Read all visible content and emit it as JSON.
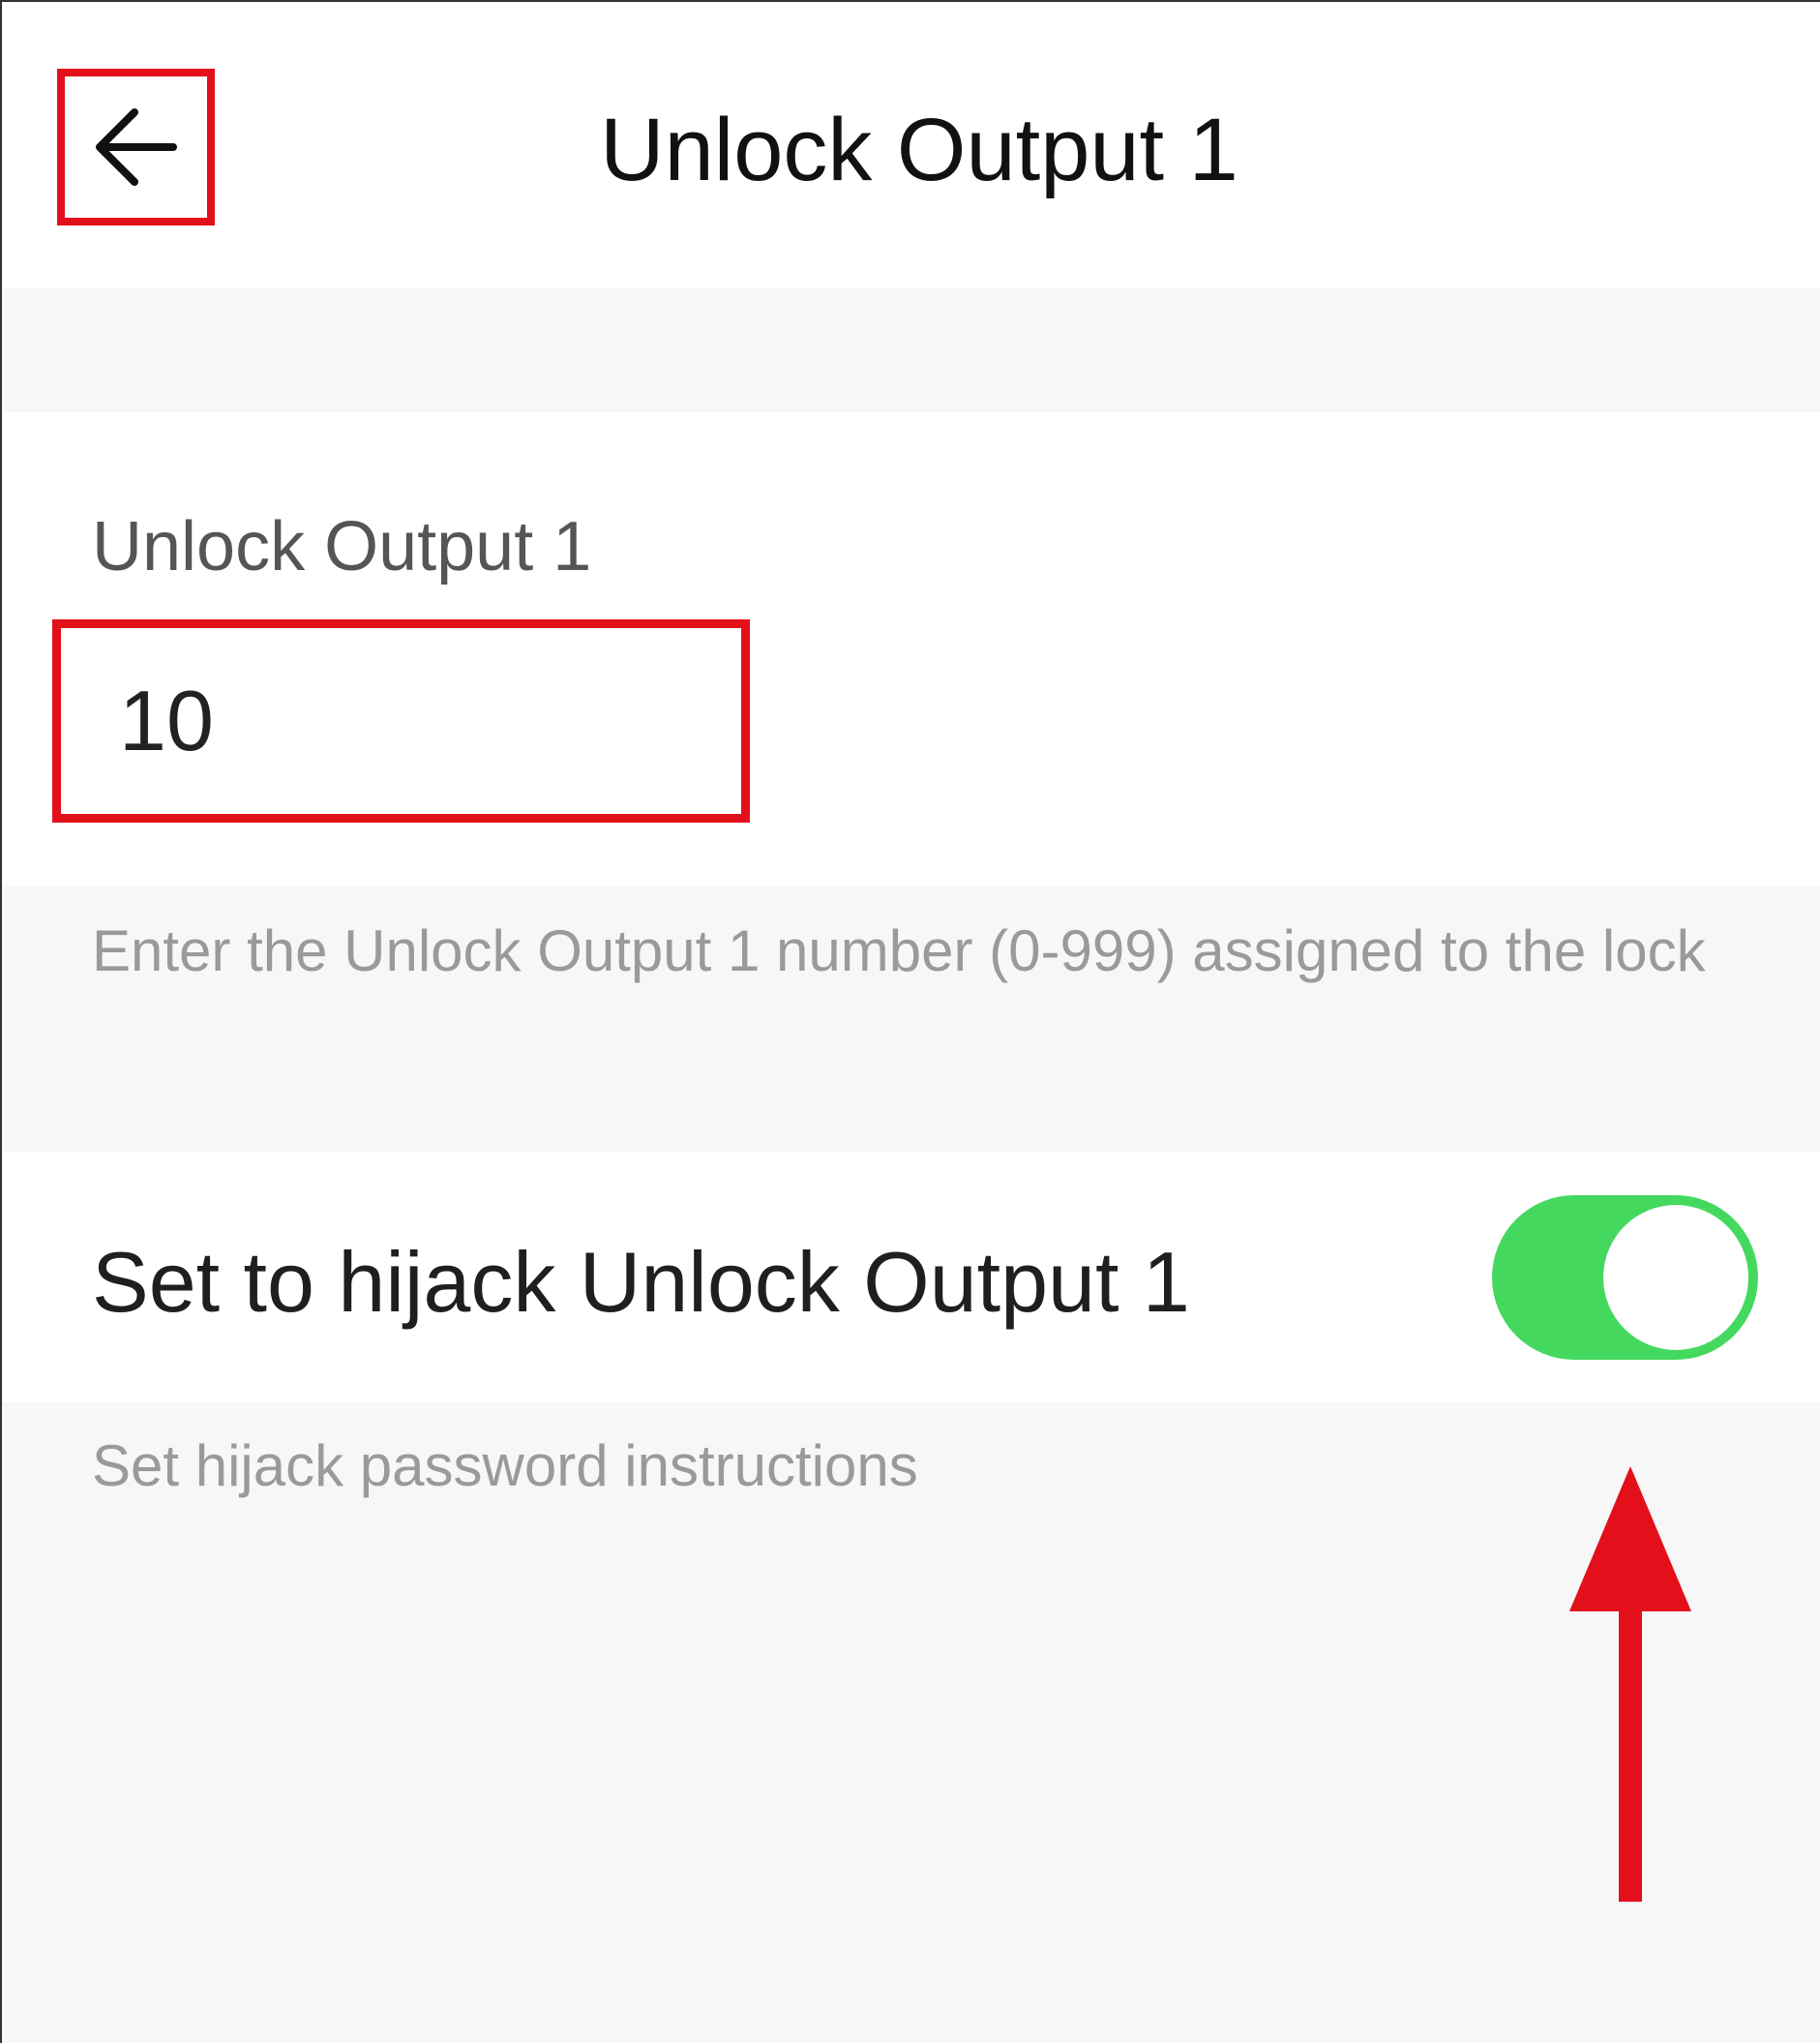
{
  "header": {
    "title": "Unlock Output 1",
    "back_icon": "arrow-left-icon"
  },
  "unlock_output": {
    "label": "Unlock Output 1",
    "value": "10",
    "hint": "Enter the Unlock Output 1 number (0-999) assigned to the lock"
  },
  "hijack": {
    "label": "Set to hijack Unlock Output 1",
    "enabled": true,
    "hint": "Set hijack password instructions"
  },
  "colors": {
    "highlight": "#e3101b",
    "toggle_on": "#44d95e",
    "background": "#f7f7f7"
  },
  "annotation": {
    "arrow_icon": "arrow-up-icon"
  }
}
